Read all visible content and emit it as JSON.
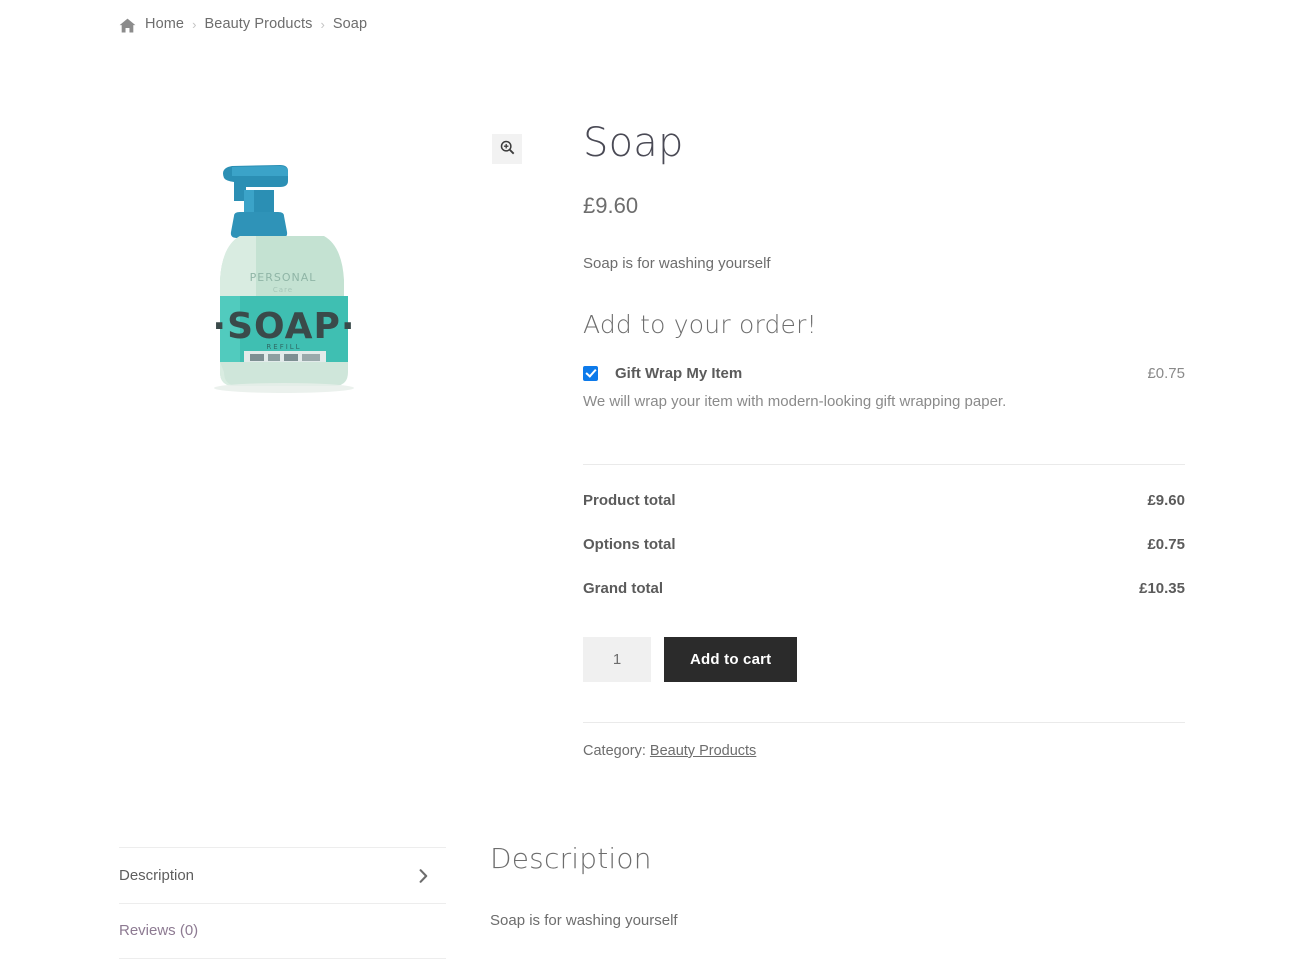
{
  "breadcrumb": {
    "home_icon": "home-icon",
    "separator": "›",
    "items": [
      {
        "label": "Home",
        "link": true
      },
      {
        "label": "Beauty Products",
        "link": true
      },
      {
        "label": "Soap",
        "link": false
      }
    ]
  },
  "gallery": {
    "zoom_button_icon": "magnifier-plus-icon",
    "image_alt": "Soap pump bottle",
    "product_image": {
      "label_text": "·SOAP·",
      "colors": {
        "pump": "#2b8fb4",
        "pump_dark": "#1f7ea5",
        "bottle_body": "#bfdfd0",
        "bottle_body_light": "#d6eade",
        "label_band": "#3fbfb2",
        "label_text": "#3a4a4a",
        "sticker": "#dfe7e7"
      }
    }
  },
  "summary": {
    "title": "Soap",
    "price": "£9.60",
    "short_description": "Soap is for washing yourself"
  },
  "addons": {
    "heading": "Add to your order!",
    "options": [
      {
        "checked": true,
        "label": "Gift Wrap My Item",
        "price": "£0.75",
        "description": "We will wrap your item with modern-looking gift wrapping paper."
      }
    ]
  },
  "totals": [
    {
      "label": "Product total",
      "value": "£9.60"
    },
    {
      "label": "Options total",
      "value": "£0.75"
    },
    {
      "label": "Grand total",
      "value": "£10.35"
    }
  ],
  "cart": {
    "quantity_value": "1",
    "quantity_placeholder": "1",
    "add_to_cart_label": "Add to cart"
  },
  "meta": {
    "category_prefix": "Category:",
    "category_label": "Beauty Products"
  },
  "tabs": {
    "items": [
      {
        "label": "Description",
        "active": true,
        "chevron_icon": "chevron-right-icon"
      },
      {
        "label": "Reviews (0)",
        "active": false,
        "chevron_icon": ""
      }
    ]
  },
  "panel": {
    "heading": "Description",
    "text": "Soap is for washing yourself"
  },
  "colors": {
    "accent_checkbox": "#0d7aea",
    "button_dark": "#2b2b2b",
    "text_gray": "#6d6d6d",
    "link_purple": "#8d7a92",
    "divider": "#ededed",
    "qty_bg": "#f0f0f0"
  }
}
